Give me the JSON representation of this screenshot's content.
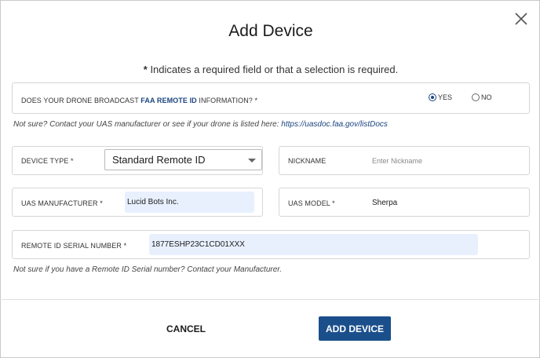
{
  "dialog": {
    "title": "Add Device",
    "required_note_star": "*",
    "required_note_text": " Indicates a required field or that a selection is required.",
    "close_icon": "close-icon"
  },
  "remote_id_question": {
    "label_prefix": "DOES YOUR DRONE BROADCAST ",
    "label_accent": "FAA REMOTE ID",
    "label_suffix": " INFORMATION? *",
    "options": [
      {
        "label": "YES",
        "selected": true
      },
      {
        "label": "NO",
        "selected": false
      }
    ],
    "hint_text": "Not sure? Contact your UAS manufacturer or see if your drone is listed here: ",
    "hint_link": "https://uasdoc.faa.gov/listDocs"
  },
  "device_type": {
    "label": "DEVICE TYPE *",
    "selected": "Standard Remote ID"
  },
  "nickname": {
    "label": "NICKNAME",
    "placeholder": "Enter Nickname",
    "value": ""
  },
  "uas_manufacturer": {
    "label": "UAS MANUFACTURER *",
    "value": "Lucid Bots Inc."
  },
  "uas_model": {
    "label": "UAS MODEL *",
    "value": "Sherpa"
  },
  "serial_number": {
    "label": "REMOTE ID SERIAL NUMBER *",
    "value": "1877ESHP23C1CD01XXX",
    "hint": "Not sure if you have a Remote ID Serial number? Contact your Manufacturer."
  },
  "actions": {
    "cancel_label": "CANCEL",
    "add_label": "ADD DEVICE"
  },
  "colors": {
    "primary": "#1a4f8b",
    "accent_text": "#1a4480",
    "autofill_bg": "#e8f0fe"
  }
}
